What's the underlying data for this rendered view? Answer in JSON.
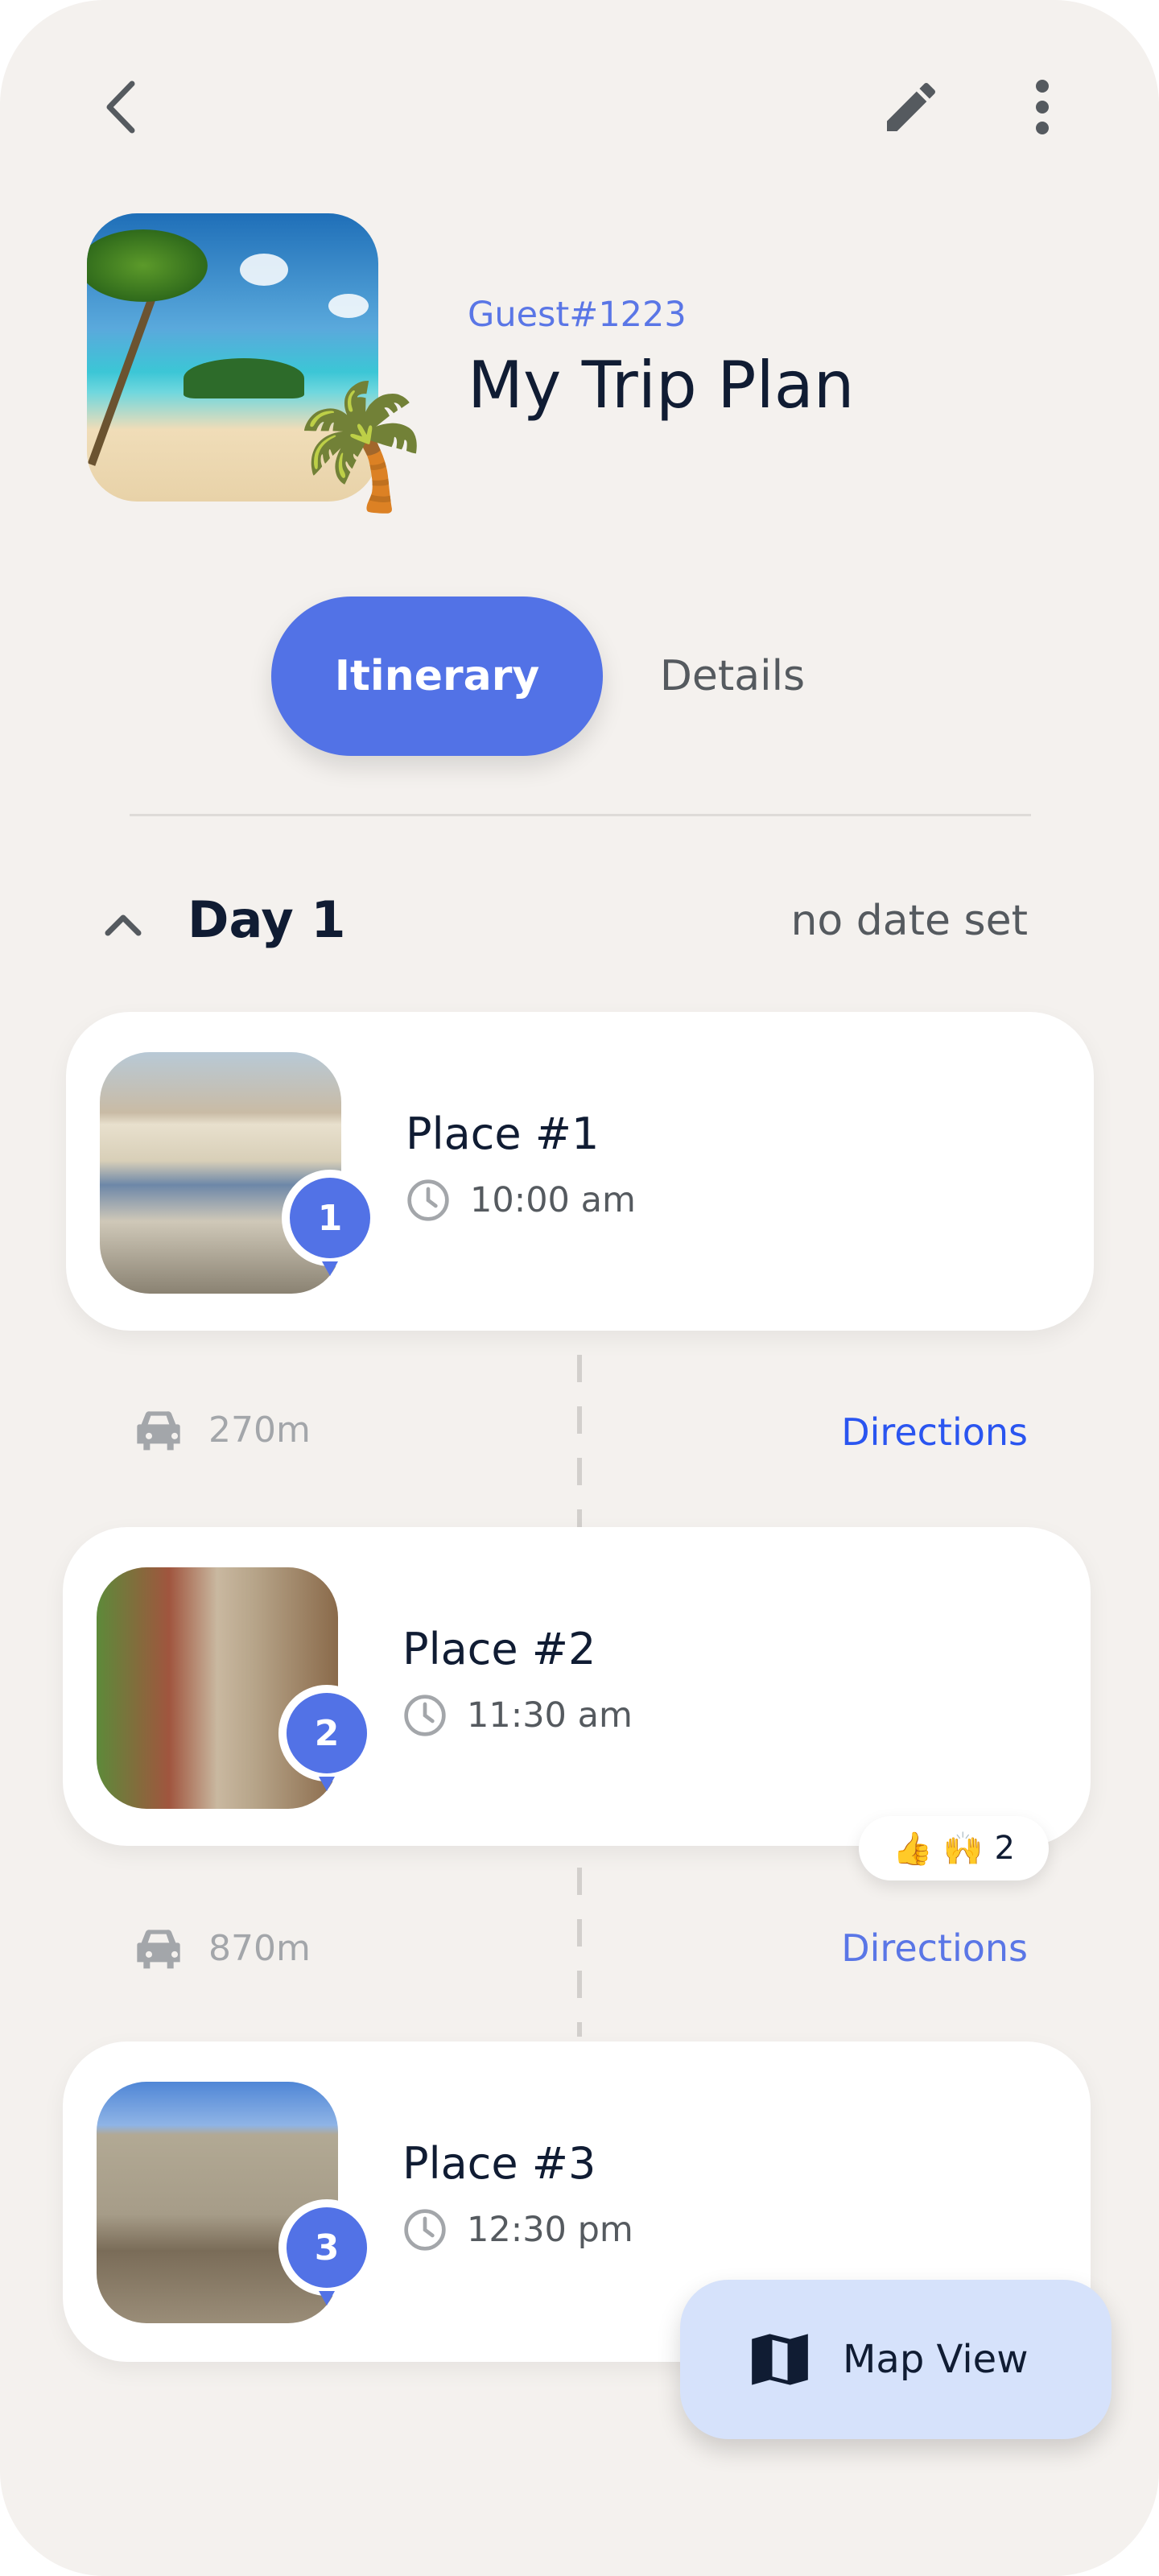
{
  "header": {
    "back_icon": "chevron-left-icon",
    "edit_icon": "pencil-icon",
    "more_icon": "more-vertical-icon"
  },
  "trip": {
    "owner": "Guest#1223",
    "title": "My Trip Plan",
    "cover_emoji": "🌴"
  },
  "tabs": [
    {
      "label": "Itinerary",
      "active": true
    },
    {
      "label": "Details",
      "active": false
    }
  ],
  "day": {
    "label": "Day 1",
    "date": "no date set",
    "expanded": true
  },
  "places": [
    {
      "number": "1",
      "name": "Place #1",
      "time": "10:00 am"
    },
    {
      "number": "2",
      "name": "Place #2",
      "time": "11:30 am",
      "reactions": {
        "emojis": "👍 🙌",
        "count": "2"
      }
    },
    {
      "number": "3",
      "name": "Place #3",
      "time": "12:30 pm"
    }
  ],
  "legs": [
    {
      "distance": "270m",
      "directions": "Directions"
    },
    {
      "distance": "870m",
      "directions": "Directions"
    }
  ],
  "fab": {
    "label": "Map View",
    "icon": "map-icon"
  },
  "colors": {
    "accent": "#5272e6",
    "link": "#2a55f0",
    "background": "#f4f1ee",
    "fab": "#d6e2fb"
  }
}
